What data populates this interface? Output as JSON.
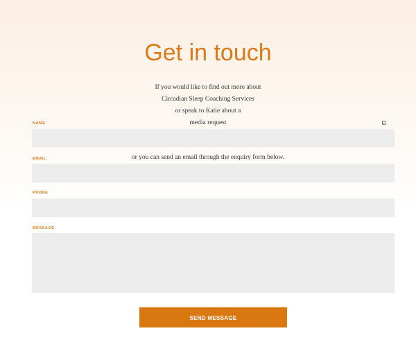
{
  "header": {
    "title": "Get in touch"
  },
  "intro": {
    "line1": "If you would like to find out more about",
    "line2": "Circadian Sleep Coaching Services",
    "line3": "or speak to Katie about a",
    "line4": "media request",
    "line5": "or you can send an email through the enquiry form below."
  },
  "form": {
    "name_label": "NAME",
    "email_label": "EMAIL",
    "phone_label": "PHONE",
    "message_label": "MESSAGE",
    "name_value": "",
    "email_value": "",
    "phone_value": "",
    "message_value": "",
    "submit_label": "SEND MESSAGE"
  },
  "colors": {
    "accent": "#d97a16",
    "field_bg": "#ececec",
    "button_bg": "#d97711"
  }
}
